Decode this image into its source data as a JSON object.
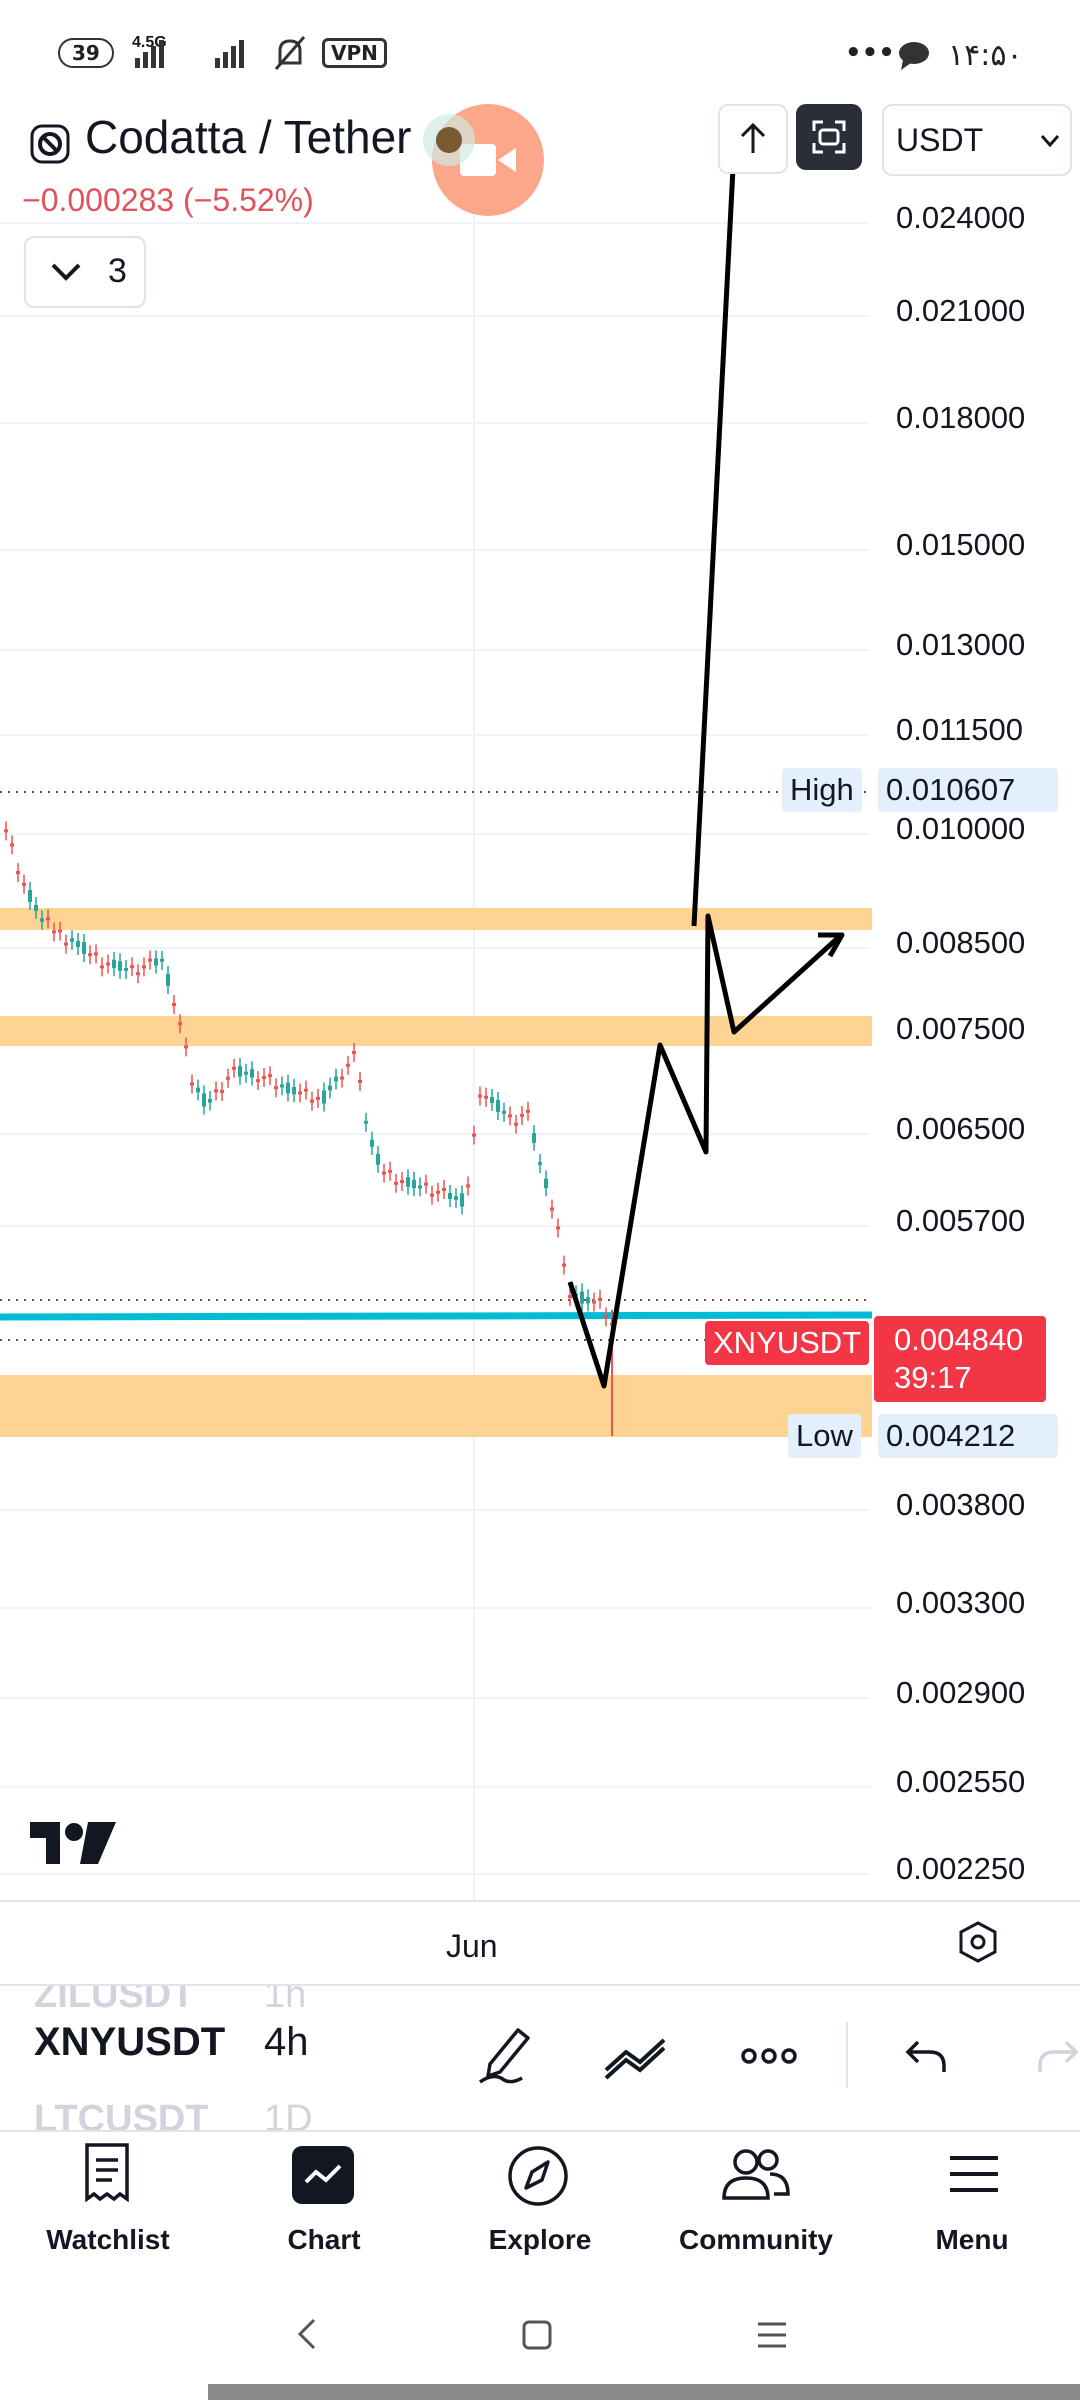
{
  "status_bar": {
    "notif_count": "39",
    "network": "4.5G",
    "vpn": "VPN",
    "more": "•••",
    "time": "۱۴:۵۰"
  },
  "header": {
    "symbol_title": "Codatta / Tether",
    "change": "−0.000283 (−5.52%)",
    "indicators_count": "3",
    "currency_select": "USDT",
    "currency_options": [
      "USDT"
    ]
  },
  "price_axis": {
    "labels": [
      "0.024000",
      "0.021000",
      "0.018000",
      "0.015000",
      "0.013000",
      "0.011500",
      "0.010000",
      "0.008500",
      "0.007500",
      "0.006500",
      "0.005700",
      "0.003800",
      "0.003300",
      "0.002900",
      "0.002550",
      "0.002250"
    ],
    "high_label": "High",
    "high_value": "0.010607",
    "low_label": "Low",
    "low_value": "0.004212",
    "current_symbol": "XNYUSDT",
    "current_price": "0.004840",
    "countdown": "39:17"
  },
  "time_axis": {
    "label": "Jun"
  },
  "symbol_picker": {
    "prev_symbol": "ZILUSDT",
    "prev_interval": "1h",
    "symbol": "XNYUSDT",
    "interval": "4h",
    "next_symbol": "LTCUSDT",
    "next_interval": "1D"
  },
  "bottom_nav": {
    "items": [
      "Watchlist",
      "Chart",
      "Explore",
      "Community",
      "Menu"
    ]
  },
  "colors": {
    "up": "#26a69a",
    "down": "#ef5350",
    "zone": "#ffcc80",
    "trendline": "#00bcd4",
    "price_tag": "#f23645",
    "logo": "tradingview"
  },
  "icons": [
    "pen-icon",
    "trendline-tool-icon",
    "more-icon",
    "undo-icon",
    "redo-icon",
    "settings-hex-icon",
    "fullscreen-icon",
    "arrow-up-icon",
    "video-record-icon"
  ]
}
